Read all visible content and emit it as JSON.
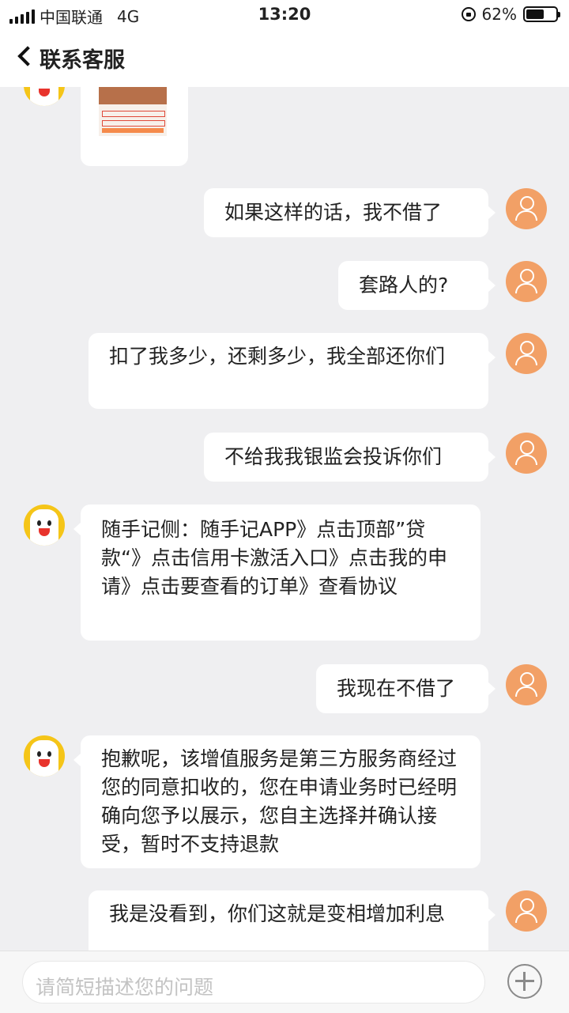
{
  "status_bar": {
    "carrier": "中国联通",
    "network": "4G",
    "time": "13:20",
    "battery": "62%",
    "battery_level": 0.62
  },
  "header": {
    "title": "联系客服"
  },
  "messages": [
    {
      "from": "user",
      "text": "如果这样的话，我不借了"
    },
    {
      "from": "user",
      "text": "套路人的?"
    },
    {
      "from": "user",
      "text": "扣了我多少，还剩多少，我全部还你们"
    },
    {
      "from": "user",
      "text": "不给我我银监会投诉你们"
    },
    {
      "from": "agent",
      "text": "随手记侧：随手记APP》点击顶部”贷款“》点击信用卡激活入口》点击我的申请》点击要查看的订单》查看协议"
    },
    {
      "from": "user",
      "text": "我现在不借了"
    },
    {
      "from": "agent",
      "text": "抱歉呢，该增值服务是第三方服务商经过您的同意扣收的，您在申请业务时已经明确向您予以展示，您自主选择并确认接受，暂时不支持退款"
    },
    {
      "from": "user",
      "text": "我是没看到，你们这就是变相增加利息"
    }
  ],
  "composer": {
    "placeholder": "请简短描述您的问题"
  },
  "colors": {
    "user_avatar": "#f2a066",
    "bot_avatar": "#f5c518",
    "background": "#efeff1"
  }
}
